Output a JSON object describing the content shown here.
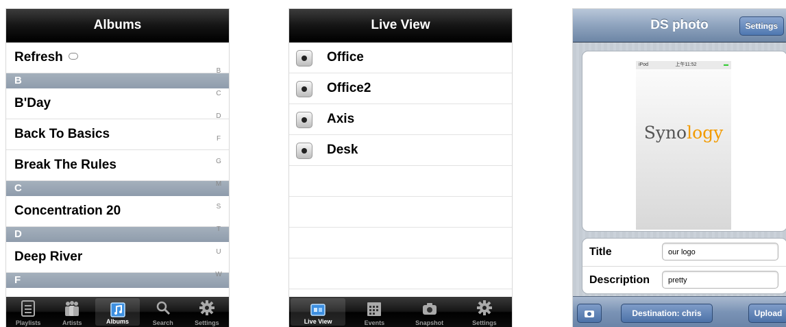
{
  "albums": {
    "title": "Albums",
    "rows": [
      {
        "type": "item",
        "label": "Refresh"
      },
      {
        "type": "header",
        "label": "B"
      },
      {
        "type": "item",
        "label": "B'Day"
      },
      {
        "type": "item",
        "label": "Back To Basics"
      },
      {
        "type": "item",
        "label": "Break The Rules"
      },
      {
        "type": "header",
        "label": "C"
      },
      {
        "type": "item",
        "label": "Concentration 20"
      },
      {
        "type": "header",
        "label": "D"
      },
      {
        "type": "item",
        "label": "Deep River"
      },
      {
        "type": "header",
        "label": "F"
      }
    ],
    "index": [
      "B",
      "C",
      "D",
      "F",
      "G",
      "M",
      "S",
      "T",
      "U",
      "W"
    ],
    "tabs": [
      {
        "label": "Playlists",
        "icon": "playlist-icon"
      },
      {
        "label": "Artists",
        "icon": "artists-icon"
      },
      {
        "label": "Albums",
        "icon": "albums-icon",
        "active": true
      },
      {
        "label": "Search",
        "icon": "search-icon"
      },
      {
        "label": "Settings",
        "icon": "gear-icon"
      }
    ]
  },
  "live_view": {
    "title": "Live View",
    "cameras": [
      "Office",
      "Office2",
      "Axis",
      "Desk"
    ],
    "tabs": [
      {
        "label": "Live View",
        "icon": "live-view-icon",
        "active": true
      },
      {
        "label": "Events",
        "icon": "calendar-icon"
      },
      {
        "label": "Snapshot",
        "icon": "camera-icon"
      },
      {
        "label": "Settings",
        "icon": "gear-icon"
      }
    ]
  },
  "ds_photo": {
    "title": "DS photo",
    "settings_button": "Settings",
    "preview": {
      "status_left": "iPod",
      "status_time": "上午11:52",
      "logo_main": "Syno",
      "logo_accent": "logy"
    },
    "form": {
      "title_label": "Title",
      "title_value": "our logo",
      "description_label": "Description",
      "description_value": "pretty"
    },
    "destination_button": "Destination: chris",
    "upload_button": "Upload"
  }
}
